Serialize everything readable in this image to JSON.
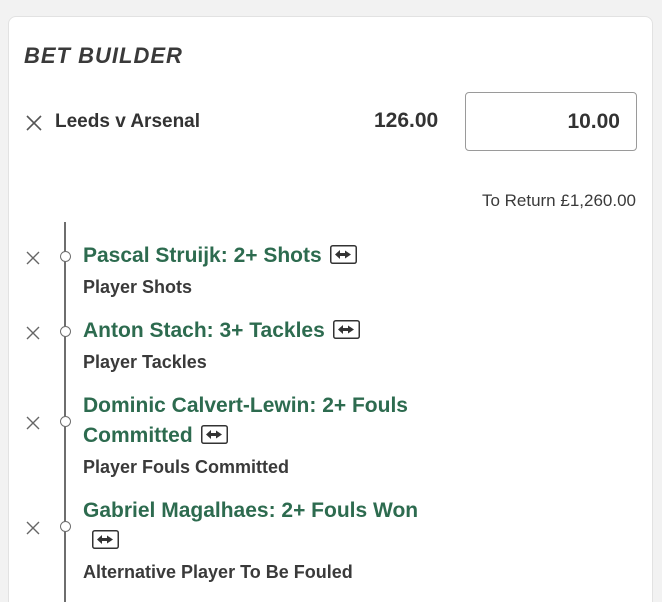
{
  "bet_builder": {
    "title": "BET BUILDER",
    "match": {
      "name": "Leeds v Arsenal",
      "odds": "126.00",
      "stake": "10.00"
    },
    "to_return": "To Return £1,260.00",
    "selections": [
      {
        "title": "Pascal Struijk: 2+ Shots",
        "market": "Player Shots"
      },
      {
        "title_line1": "Anton Stach: 3+ Tackles",
        "market": "Player Tackles"
      },
      {
        "title_line1": "Dominic Calvert-Lewin: 2+ Fouls",
        "title_line2": "Committed",
        "market": "Player Fouls Committed"
      },
      {
        "title_line1": "Gabriel Magalhaes: 2+ Fouls Won",
        "market": "Alternative Player To Be Fouled"
      }
    ]
  },
  "icons": {
    "remove": "close-icon",
    "swap": "swap-player-icon"
  },
  "colors": {
    "selection_green": "#2d6b4f",
    "text_dark": "#333333"
  }
}
